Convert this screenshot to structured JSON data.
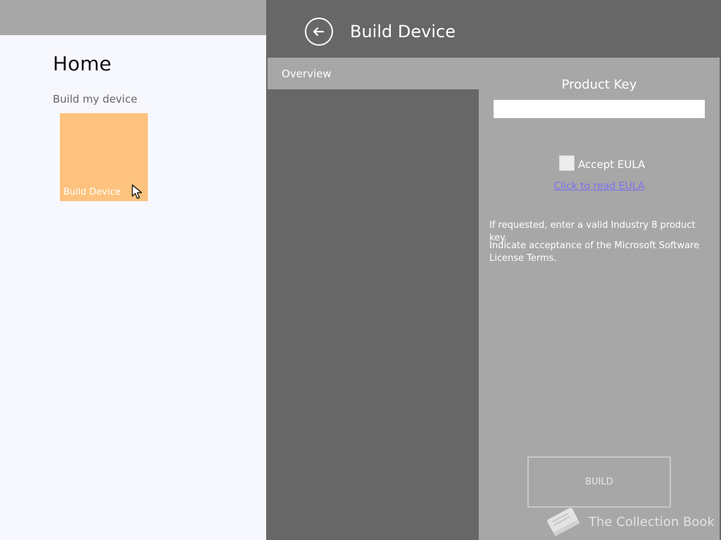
{
  "home": {
    "title": "Home",
    "section_label": "Build my device",
    "tile_label": "Build Device",
    "tile_color": "#fdc27d"
  },
  "flyout": {
    "title": "Build Device",
    "tab_label": "Overview",
    "product_key_label": "Product Key",
    "product_key_value": "",
    "accept_eula_label": "Accept EULA",
    "accept_eula_checked": false,
    "eula_link": "Click to read EULA",
    "help_text_1": "If requested, enter a valid Industry 8 product key.",
    "help_text_2": "Indicate acceptance of the Microsoft Software License Terms.",
    "build_button": "BUILD"
  },
  "watermark": {
    "text": "The Collection Book",
    "icon": "book-icon"
  },
  "icons": {
    "back": "back-arrow-icon",
    "cursor": "mouse-cursor-icon"
  },
  "colors": {
    "flyout_bg": "#676767",
    "panel_bg": "#a7a7a7",
    "link": "#7d6ff0"
  }
}
